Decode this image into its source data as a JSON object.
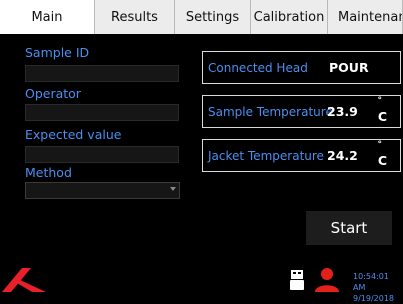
{
  "tabs": [
    {
      "label": "Main",
      "active": true
    },
    {
      "label": "Results",
      "active": false
    },
    {
      "label": "Settings",
      "active": false
    },
    {
      "label": "Calibration",
      "active": false
    },
    {
      "label": "Maintenance",
      "active": false
    }
  ],
  "form": {
    "sample_id_label": "Sample ID",
    "sample_id_value": "",
    "operator_label": "Operator",
    "operator_value": "",
    "expected_value_label": "Expected value",
    "expected_value_value": "",
    "method_label": "Method",
    "method_value": ""
  },
  "status": {
    "connected_head_label": "Connected Head",
    "connected_head_value": "POUR",
    "sample_temperature_label": "Sample Temperature",
    "sample_temperature_value": "23.9",
    "sample_temperature_unit": "C",
    "jacket_temperature_label": "Jacket Temperature",
    "jacket_temperature_value": "24.2",
    "jacket_temperature_unit": "C",
    "degree_symbol": "°"
  },
  "actions": {
    "start_label": "Start"
  },
  "footer": {
    "time": "10:54:01 AM",
    "date": "9/19/2018"
  },
  "colors": {
    "accent": "#4b8ff0",
    "logo": "#e8202a",
    "user_icon": "#e32119"
  },
  "icons": {
    "logo": "brand-logo",
    "usb": "usb-device-icon",
    "user": "user-icon"
  }
}
